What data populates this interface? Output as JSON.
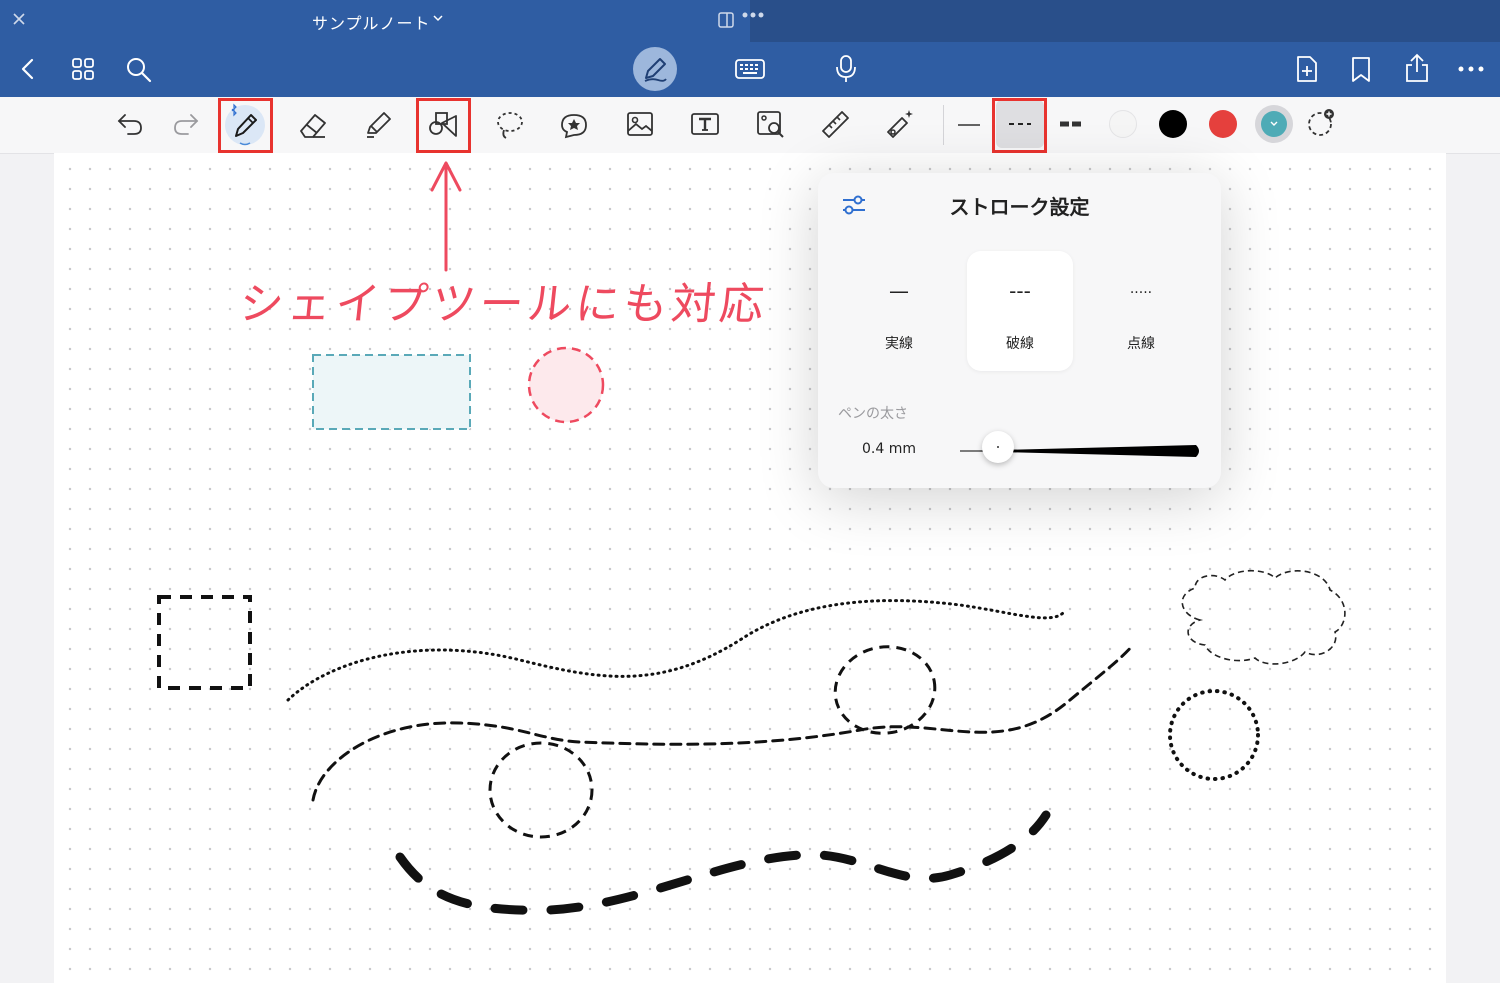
{
  "titlebar": {
    "title": "サンプルノート"
  },
  "annotation": {
    "text": "シェイプツールにも対応"
  },
  "popover": {
    "title": "ストローク設定",
    "styles": [
      {
        "symbol": "—",
        "label": "実線"
      },
      {
        "symbol": "---",
        "label": "破線"
      },
      {
        "symbol": ".....",
        "label": "点線"
      }
    ],
    "pen_width_label": "ペンの太さ",
    "pen_width_value": "0.4 mm",
    "pen_width_fraction": 0.16
  },
  "colors": {
    "white": "#f5f5f5",
    "black": "#000000",
    "red": "#e5403d",
    "teal": "#4eabb6",
    "accent_red": "#e8332f",
    "nav_blue": "#2f5da3"
  },
  "icons": [
    "close-icon",
    "back-icon",
    "grid-icon",
    "search-icon",
    "pen-mode-icon",
    "keyboard-icon",
    "microphone-icon",
    "add-page-icon",
    "bookmark-icon",
    "share-icon",
    "more-icon",
    "undo-icon",
    "redo-icon",
    "pen-icon",
    "eraser-icon",
    "highlighter-icon",
    "shape-icon",
    "lasso-icon",
    "sticker-icon",
    "image-icon",
    "textbox-icon",
    "image-scan-icon",
    "ruler-icon",
    "laser-icon",
    "add-color-icon"
  ]
}
